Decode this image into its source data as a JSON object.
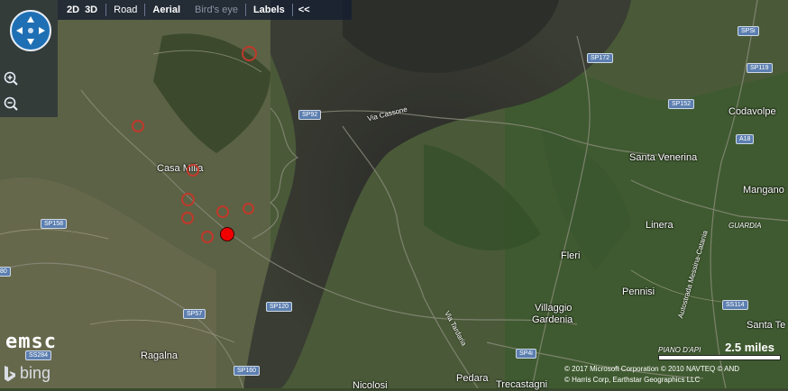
{
  "toolbar": {
    "mode_2d": "2D",
    "mode_3d": "3D",
    "road": "Road",
    "aerial": "Aerial",
    "birds_eye": "Bird's eye",
    "labels": "Labels",
    "collapse": "<<"
  },
  "places": [
    {
      "name": "Casa Milia"
    },
    {
      "name": "Santa Venerina"
    },
    {
      "name": "Codavolpe"
    },
    {
      "name": "Mangano"
    },
    {
      "name": "Linera"
    },
    {
      "name": "Fleri"
    },
    {
      "name": "Pennisi"
    },
    {
      "name": "Villaggio"
    },
    {
      "name": "Gardenia"
    },
    {
      "name": "Ragalna"
    },
    {
      "name": "Pedara"
    },
    {
      "name": "Trecastagni"
    },
    {
      "name": "Nicolosi"
    },
    {
      "name": "Santa Te"
    }
  ],
  "road_signs": [
    "SPSi",
    "SP172",
    "SP119",
    "SP92",
    "SP152",
    "A18",
    "SP158",
    "SS114",
    "SP57",
    "SP120",
    "SP160",
    "SP4i",
    "SS284",
    "80"
  ],
  "road_names": [
    "Via Cassone",
    "Via Tardaria",
    "Autostrada Messina-Catania",
    "GUARDIA",
    "PIANO D'API",
    "AND"
  ],
  "scale": {
    "label": "2.5 miles"
  },
  "copyright": {
    "line1": "© 2017 Microsoft Corporation   © 2010 NAVTEQ   © AND",
    "line2": "© Harris Corp, Earthstar Geographics LLC"
  },
  "logos": {
    "emsc": "emsc",
    "bing": "bing"
  },
  "colors": {
    "quake_ring": "#c0392b",
    "main_quake": "#f10000",
    "toolbar_bg": "#141e32",
    "road_sign": "#5c7fb0"
  },
  "icons": [
    "compass-pan-icon",
    "zoom-in-icon",
    "zoom-out-icon",
    "bing-logo-icon"
  ]
}
